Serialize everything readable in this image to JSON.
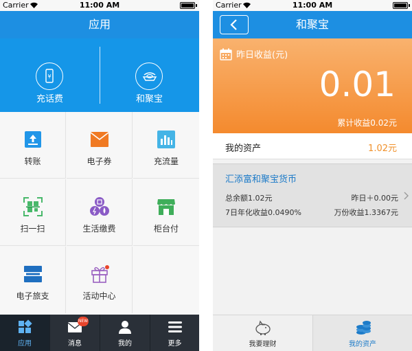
{
  "status_bar": {
    "carrier": "Carrier",
    "time": "11:00 AM"
  },
  "left": {
    "title": "应用",
    "hero": [
      {
        "label": "充话费",
        "icon": "phone-recharge-icon"
      },
      {
        "label": "和聚宝",
        "icon": "gold-ingot-icon"
      }
    ],
    "grid": [
      {
        "label": "转账",
        "icon": "transfer-icon",
        "color": "#2196e8"
      },
      {
        "label": "电子券",
        "icon": "coupon-icon",
        "color": "#f07a23"
      },
      {
        "label": "充流量",
        "icon": "data-chart-icon",
        "color": "#45b4e6"
      },
      {
        "label": "扫一扫",
        "icon": "qr-scan-icon",
        "color": "#48b86a"
      },
      {
        "label": "生活缴费",
        "icon": "bill-pay-icon",
        "color": "#8a5bc6"
      },
      {
        "label": "柜台付",
        "icon": "store-icon",
        "color": "#3fae5a"
      },
      {
        "label": "电子旅支",
        "icon": "travel-card-icon",
        "color": "#1f6fc0"
      },
      {
        "label": "活动中心",
        "icon": "gift-icon",
        "color": "#9a60c0"
      }
    ],
    "tabs": [
      {
        "label": "应用",
        "icon": "apps-grid-icon",
        "active": true
      },
      {
        "label": "消息",
        "icon": "envelope-icon",
        "badge": "NEW"
      },
      {
        "label": "我的",
        "icon": "user-icon"
      },
      {
        "label": "更多",
        "icon": "menu-icon"
      }
    ]
  },
  "right": {
    "title": "和聚宝",
    "yesterday_label": "昨日收益(元)",
    "yesterday_value": "0.01",
    "total_yield": "累计收益0.02元",
    "asset_label": "我的资产",
    "asset_value": "1.02元",
    "fund": {
      "name": "汇添富和聚宝货币",
      "balance": "总余额1.02元",
      "yesterday": "昨日＋0.00元",
      "annual": "7日年化收益0.0490%",
      "per_ten_thousand": "万份收益1.3367元"
    },
    "tabs": [
      {
        "label": "我要理财",
        "icon": "piggy-bank-icon"
      },
      {
        "label": "我的资产",
        "icon": "coin-stack-icon",
        "active": true
      }
    ]
  },
  "colors": {
    "nav_blue": "#1d8fe2",
    "orange": "#f48a2e",
    "link_blue": "#1d7bc8",
    "tab_dark": "#2a3038"
  }
}
